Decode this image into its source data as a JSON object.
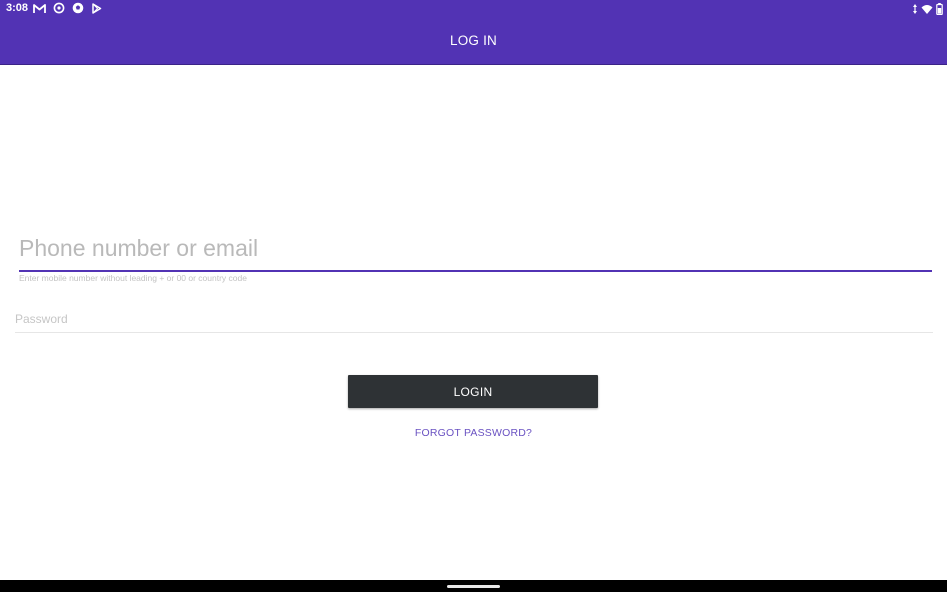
{
  "status_bar": {
    "time": "3:08",
    "left_icons": [
      "gmail-icon",
      "sync-icon",
      "football-icon",
      "play-store-icon"
    ],
    "right_icons": [
      "data-arrows-icon",
      "wifi-icon",
      "battery-icon"
    ]
  },
  "app_bar": {
    "title": "LOG IN",
    "color": "#5233b4"
  },
  "form": {
    "phone_placeholder": "Phone number or email",
    "phone_value": "",
    "phone_helper": "Enter mobile number without leading + or 00 or country code",
    "password_placeholder": "Password",
    "password_value": "",
    "login_label": "LOGIN",
    "forgot_label": "FORGOT PASSWORD?"
  },
  "colors": {
    "accent": "#5233b4",
    "button": "#2e3235",
    "link": "#6a52c2"
  }
}
